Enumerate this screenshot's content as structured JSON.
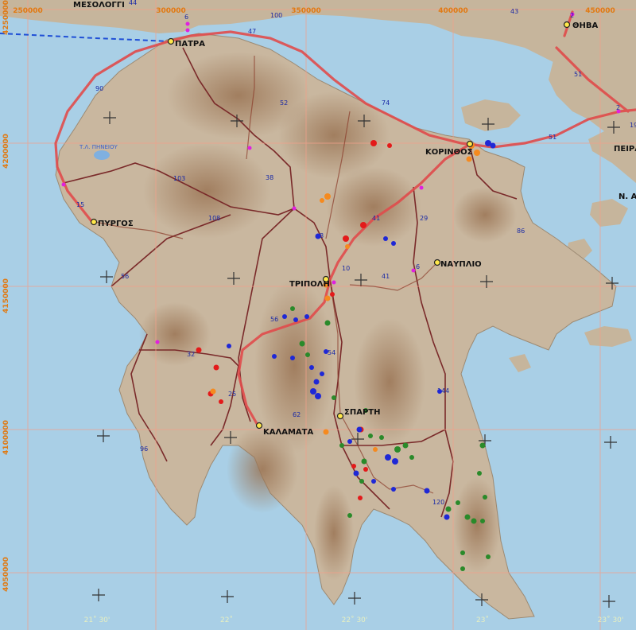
{
  "colors": {
    "sea": "#a9cfe6",
    "land": "#c9b79f",
    "land_dark": "#b39a7e",
    "highland": "#a88363",
    "grid": "#f3a08a",
    "road": "#e04b4b",
    "border": "#7a2a2a",
    "ferry": "#1f4fd6",
    "marker_red": "#e31a1a",
    "marker_orange": "#f58a1f",
    "marker_blue": "#1f28d6",
    "marker_green": "#2a8a2a"
  },
  "grid_labels": {
    "x": [
      "250000",
      "300000",
      "350000",
      "400000",
      "450000"
    ],
    "y": [
      "4250000",
      "4200000",
      "4150000",
      "4100000",
      "4050000"
    ]
  },
  "lon_labels": [
    "21˚ 30'",
    "22˚",
    "22˚ 30'",
    "23˚",
    "23˚ 30'"
  ],
  "cities": [
    {
      "name": "ΜΕΣΟΛΟΓΓΙ",
      "dot": false
    },
    {
      "name": "ΠΑΤΡΑ",
      "dot": true
    },
    {
      "name": "ΘΗΒΑ",
      "dot": true
    },
    {
      "name": "ΚΟΡΙΝΘΟΣ",
      "dot": true
    },
    {
      "name": "ΠΕΙΡΑ",
      "dot": false
    },
    {
      "name": "Ν. Α",
      "dot": false
    },
    {
      "name": "ΠΥΡΓΟΣ",
      "dot": true
    },
    {
      "name": "ΝΑΥΠΛΙΟ",
      "dot": true
    },
    {
      "name": "ΤΡΙΠΟΛΗ",
      "dot": true
    },
    {
      "name": "ΣΠΑΡΤΗ",
      "dot": true
    },
    {
      "name": "ΚΑΛΑΜΑΤΑ",
      "dot": true
    }
  ],
  "lake_label": "Τ.Λ. ΠΗΝΕΙΟΥ",
  "road_numbers": [
    "44",
    "100",
    "6",
    "47",
    "43",
    "2",
    "90",
    "52",
    "74",
    "51",
    "2",
    "19",
    "51",
    "103",
    "38",
    "15",
    "108",
    "41",
    "29",
    "86",
    "56",
    "8",
    "10",
    "41",
    "6",
    "56",
    "32",
    "54",
    "25",
    "144",
    "62",
    "96",
    "120"
  ]
}
